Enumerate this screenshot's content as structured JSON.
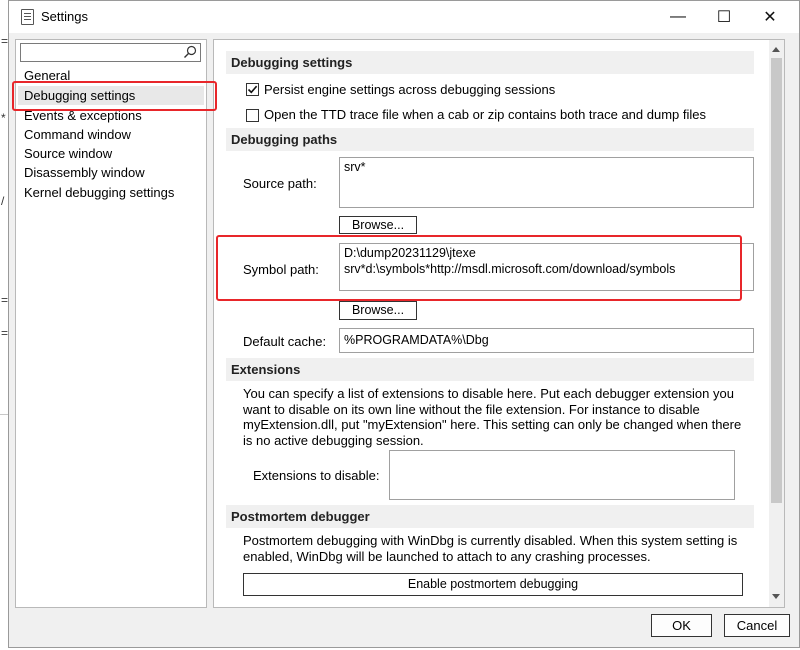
{
  "window": {
    "title": "Settings"
  },
  "titlebar": {
    "minimize": "—",
    "maximize": "☐",
    "close": "✕"
  },
  "search": {
    "value": "",
    "placeholder": ""
  },
  "sidebar": {
    "items": [
      {
        "label": "General",
        "selected": false
      },
      {
        "label": "Debugging settings",
        "selected": true
      },
      {
        "label": "Events & exceptions",
        "selected": false
      },
      {
        "label": "Command window",
        "selected": false
      },
      {
        "label": "Source window",
        "selected": false
      },
      {
        "label": "Disassembly window",
        "selected": false
      },
      {
        "label": "Kernel debugging settings",
        "selected": false
      }
    ]
  },
  "debugging_settings": {
    "heading": "Debugging settings",
    "persist": {
      "label": "Persist engine settings across debugging sessions",
      "checked": true
    },
    "ttd": {
      "label": "Open the TTD trace file when a cab or zip contains both trace and dump files",
      "checked": false
    }
  },
  "debugging_paths": {
    "heading": "Debugging paths",
    "source_label": "Source path:",
    "source_value": "srv*",
    "browse1": "Browse...",
    "symbol_label": "Symbol path:",
    "symbol_value": "D:\\dump20231129\\jtexe\nsrv*d:\\symbols*http://msdl.microsoft.com/download/symbols",
    "browse2": "Browse...",
    "cache_label": "Default cache:",
    "cache_value": "%PROGRAMDATA%\\Dbg"
  },
  "extensions": {
    "heading": "Extensions",
    "description": "You can specify a list of extensions to disable here. Put each debugger extension you want to disable on its own line without the file extension. For instance to disable myExtension.dll, put \"myExtension\" here. This setting can only be changed when there is no active debugging session.",
    "disable_label": "Extensions to disable:",
    "disable_value": ""
  },
  "postmortem": {
    "heading": "Postmortem debugger",
    "description": "Postmortem debugging with WinDbg is currently disabled. When this system setting is enabled, WinDbg will be launched to attach to any crashing processes.",
    "enable_button": "Enable postmortem debugging"
  },
  "footer": {
    "ok": "OK",
    "cancel": "Cancel"
  },
  "colors": {
    "highlight_box": "#e8262a",
    "selection": "#e8e8e8",
    "panel": "#f0f0f0"
  },
  "background": {
    "fragments": [
      "=",
      "*",
      "/",
      "=",
      "="
    ]
  }
}
